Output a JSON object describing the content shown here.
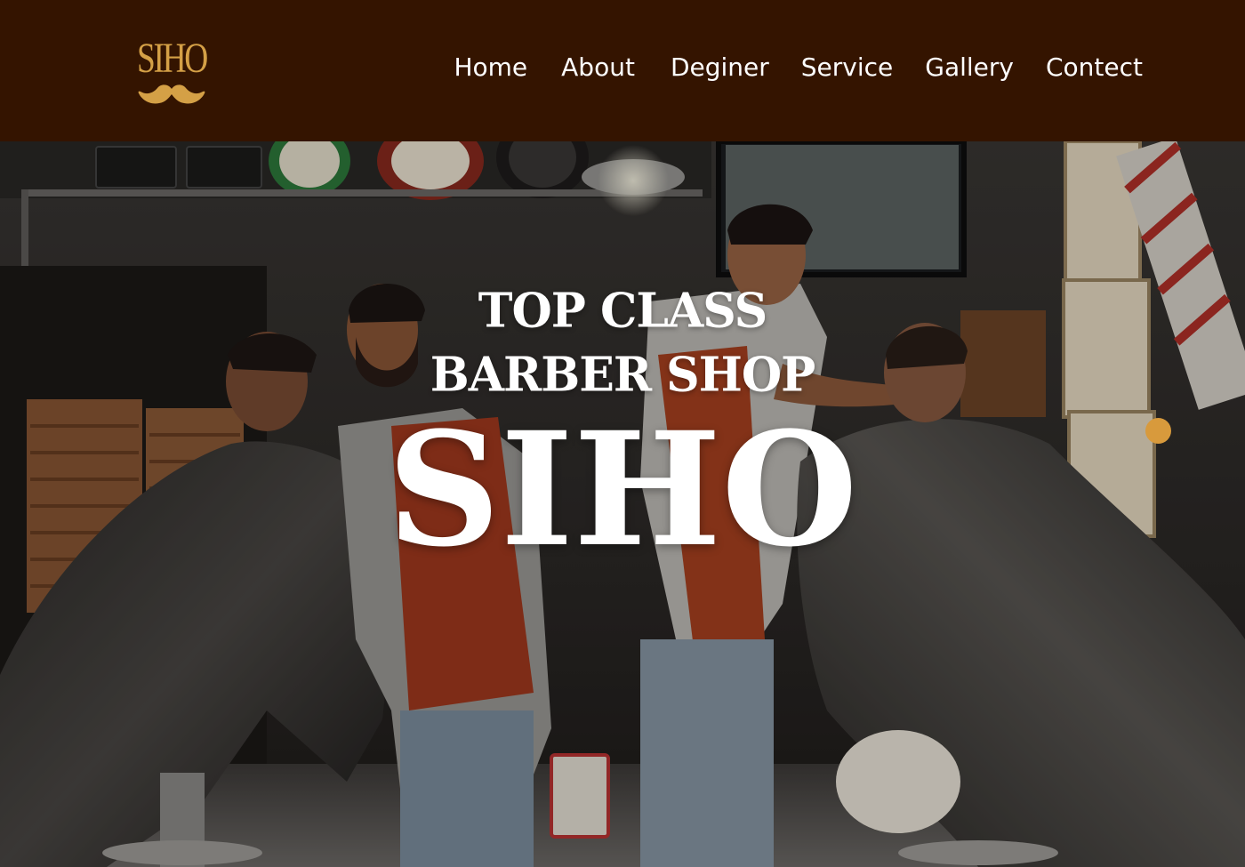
{
  "header": {
    "logo_text": "SIHO",
    "background_color": "#341400",
    "logo_color": "#d4a046"
  },
  "nav": {
    "items": [
      {
        "label": "Home"
      },
      {
        "label": "About"
      },
      {
        "label": "Deginer"
      },
      {
        "label": "Service"
      },
      {
        "label": "Gallery"
      },
      {
        "label": "Contect"
      }
    ]
  },
  "hero": {
    "subtitle_line1": "TOP CLASS",
    "subtitle_line2": "BARBER SHOP",
    "title": "SIHO",
    "slider_dot_color": "#d89a3c",
    "photo_scene": "barbershop-interior"
  }
}
